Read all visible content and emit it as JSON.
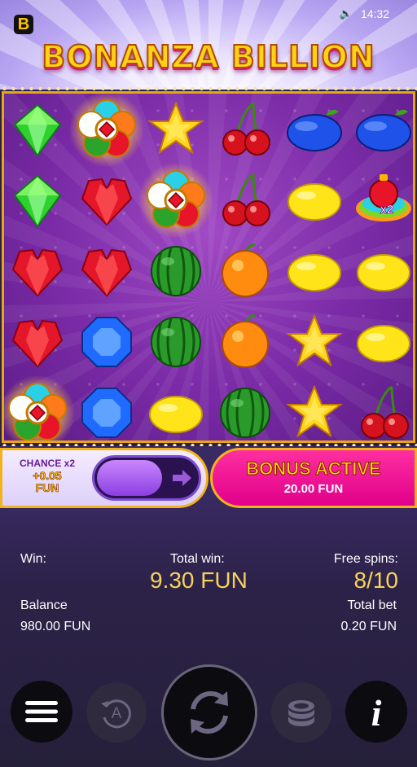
{
  "status_bar": {
    "time": "14:32",
    "sound_icon": "speaker-icon"
  },
  "app": {
    "brand_letter": "B",
    "title": "BONANZA BILLION"
  },
  "reels": {
    "rows": [
      [
        "green-gem",
        "scatter-flower",
        "star",
        "cherry",
        "blue-plum",
        "blue-plum"
      ],
      [
        "green-gem",
        "red-heart-gem",
        "scatter-flower",
        "cherry",
        "lemon",
        "multiplier-bomb"
      ],
      [
        "red-heart-gem",
        "red-heart-gem",
        "watermelon",
        "orange",
        "lemon",
        "lemon"
      ],
      [
        "red-heart-gem",
        "blue-gem",
        "watermelon",
        "orange",
        "star",
        "lemon"
      ],
      [
        "scatter-flower",
        "blue-gem",
        "lemon",
        "watermelon",
        "star",
        "cherry"
      ]
    ],
    "multiplier_label": "x2"
  },
  "chance_panel": {
    "line1": "CHANCE x2",
    "line2": "+0.05",
    "line3": "FUN"
  },
  "bonus_panel": {
    "title": "BONUS ACTIVE",
    "amount": "20.00 FUN"
  },
  "stats": {
    "win_label": "Win:",
    "total_win_label": "Total win:",
    "total_win_value": "9.30 FUN",
    "free_spins_label": "Free spins:",
    "free_spins_value": "8/10",
    "balance_label": "Balance",
    "balance_value": "980.00 FUN",
    "total_bet_label": "Total bet",
    "total_bet_value": "0.20 FUN"
  },
  "controls": {
    "menu": "menu-icon",
    "autoplay": "autoplay-icon",
    "autoplay_letter": "A",
    "spin": "spin-icon",
    "bet": "coins-icon",
    "info": "info-icon",
    "info_letter": "i"
  },
  "colors": {
    "accent_gold": "#f2b21c",
    "bonus_pink": "#e0008a",
    "value_yellow": "#f7d35a",
    "board_purple": "#7a2aa6"
  }
}
